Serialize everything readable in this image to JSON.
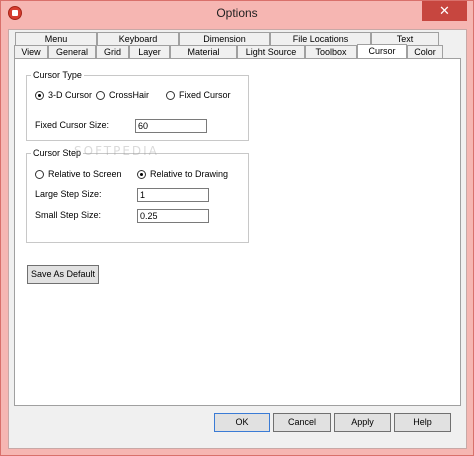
{
  "window": {
    "title": "Options",
    "close_glyph": "✕"
  },
  "tabs_row1": [
    "Menu",
    "Keyboard",
    "Dimension",
    "File Locations",
    "Text"
  ],
  "tabs_row2": [
    "View",
    "General",
    "Grid",
    "Layer",
    "Material",
    "Light Source",
    "Toolbox",
    "Cursor",
    "Color"
  ],
  "active_tab": "Cursor",
  "cursor_type": {
    "legend": "Cursor Type",
    "options": [
      "3-D Cursor",
      "CrossHair",
      "Fixed Cursor"
    ],
    "selected": "3-D Cursor",
    "fixed_size_label": "Fixed Cursor Size:",
    "fixed_size_value": "60"
  },
  "cursor_step": {
    "legend": "Cursor Step",
    "options": [
      "Relative to Screen",
      "Relative to Drawing"
    ],
    "selected": "Relative to Drawing",
    "large_label": "Large Step Size:",
    "large_value": "1",
    "small_label": "Small Step Size:",
    "small_value": "0.25"
  },
  "save_default_label": "Save As Default",
  "buttons": {
    "ok": "OK",
    "cancel": "Cancel",
    "apply": "Apply",
    "help": "Help"
  },
  "watermark": "SOFTPEDIA"
}
